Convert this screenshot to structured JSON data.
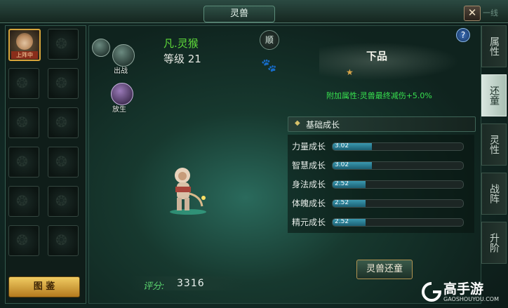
{
  "title": "灵兽",
  "close_glyph": "✕",
  "corner_text": "一线",
  "left_panel": {
    "active_slot_badge": "上阵中",
    "guide_button": "图 鉴"
  },
  "pet": {
    "name": "凡.灵猴",
    "level": "等级 21",
    "disposition": "顺",
    "grade": "下品",
    "extra_attribute": "附加属性:灵兽最终减伤+5.0%",
    "actions": {
      "fight": "出战",
      "release": "放生"
    }
  },
  "growth": {
    "header": "基础成长",
    "stats": [
      {
        "label": "力量成长",
        "value": "3.02",
        "fill": 0.3
      },
      {
        "label": "智慧成长",
        "value": "3.02",
        "fill": 0.3
      },
      {
        "label": "身法成长",
        "value": "2.52",
        "fill": 0.25
      },
      {
        "label": "体魄成长",
        "value": "2.52",
        "fill": 0.25
      },
      {
        "label": "精元成长",
        "value": "2.52",
        "fill": 0.25
      }
    ]
  },
  "restore_button": "灵兽还童",
  "score": {
    "label": "评分:",
    "value": "3316"
  },
  "right_tabs": [
    {
      "label": "属性",
      "active": false
    },
    {
      "label": "还童",
      "active": true
    },
    {
      "label": "灵性",
      "active": false
    },
    {
      "label": "战阵",
      "active": false
    },
    {
      "label": "升阶",
      "active": false
    }
  ],
  "watermark": {
    "main": "高手游",
    "sub": "GAOSHOUYOU.COM"
  },
  "colors": {
    "accent_green": "#5fdb3a",
    "gold": "#d6a43a",
    "bar_fill": "#3a99b0"
  }
}
